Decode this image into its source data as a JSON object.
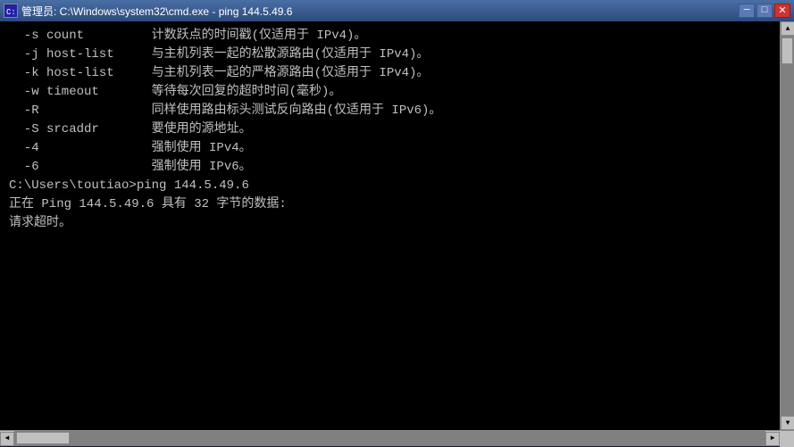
{
  "window": {
    "title": "管理员: C:\\Windows\\system32\\cmd.exe - ping  144.5.49.6",
    "icon": "▣"
  },
  "titlebar": {
    "minimize_label": "─",
    "maximize_label": "□",
    "close_label": "✕"
  },
  "console": {
    "lines": [
      "  -s count         计数跃点的时间戳(仅适用于 IPv4)。",
      "  -j host-list     与主机列表一起的松散源路由(仅适用于 IPv4)。",
      "  -k host-list     与主机列表一起的严格源路由(仅适用于 IPv4)。",
      "  -w timeout       等待每次回复的超时时间(毫秒)。",
      "  -R               同样使用路由标头测试反向路由(仅适用于 IPv6)。",
      "  -S srcaddr       要使用的源地址。",
      "  -4               强制使用 IPv4。",
      "  -6               强制使用 IPv6。",
      "",
      "",
      "C:\\Users\\toutiao>ping 144.5.49.6",
      "",
      "正在 Ping 144.5.49.6 具有 32 字节的数据:",
      "请求超时。"
    ]
  },
  "scrollbar": {
    "up_arrow": "▲",
    "down_arrow": "▼",
    "left_arrow": "◄",
    "right_arrow": "►"
  }
}
